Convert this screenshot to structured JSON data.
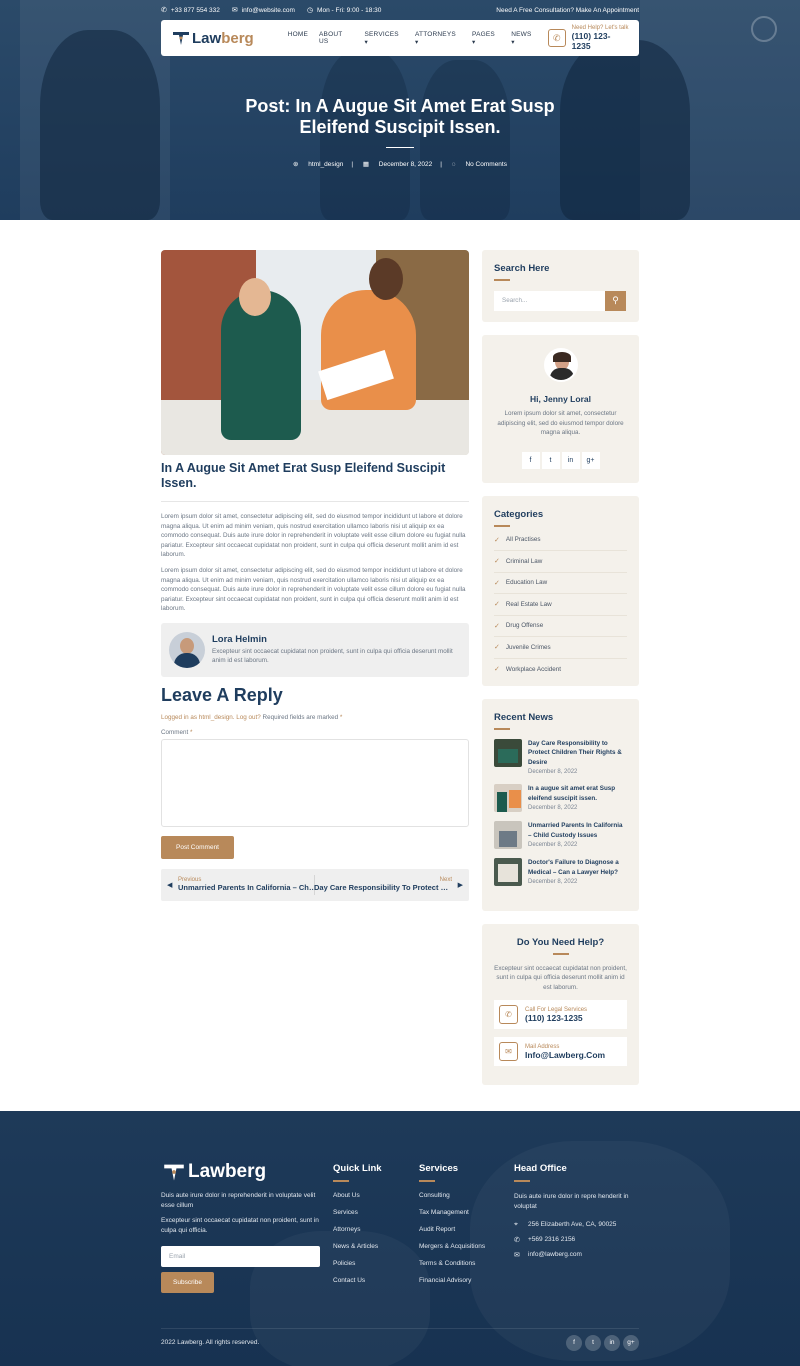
{
  "topbar": {
    "phone": "+33 877 554 332",
    "email": "info@website.com",
    "hours": "Mon - Fri: 9:00 - 18:30",
    "cta": "Need A Free Consultation? Make An Appointment"
  },
  "brand": {
    "name_a": "Law",
    "name_b": "berg"
  },
  "nav": {
    "items": [
      "HOME",
      "ABOUT US",
      "SERVICES ▾",
      "ATTORNEYS ▾",
      "PAGES ▾",
      "NEWS ▾"
    ],
    "help_label": "Need Help? Let's talk",
    "help_phone": "(110) 123-1235"
  },
  "hero": {
    "title_line1": "Post: In A Augue Sit Amet Erat Susp",
    "title_line2": "Eleifend Suscipit Issen.",
    "author": "html_design",
    "date": "December 8, 2022",
    "comments": "No Comments"
  },
  "post": {
    "title": "In A Augue Sit Amet Erat Susp Eleifend Suscipit Issen.",
    "para1": "Lorem ipsum dolor sit amet, consectetur adipiscing elit, sed do eiusmod tempor incididunt ut labore et dolore magna aliqua. Ut enim ad minim veniam, quis nostrud exercitation ullamco laboris nisi ut aliquip ex ea commodo consequat. Duis aute irure dolor in reprehenderit in voluptate velit esse cillum dolore eu fugiat nulla pariatur. Excepteur sint occaecat cupidatat non proident, sunt in culpa qui officia deserunt mollit anim id est laborum.",
    "para2": "Lorem ipsum dolor sit amet, consectetur adipiscing elit, sed do eiusmod tempor incididunt ut labore et dolore magna aliqua. Ut enim ad minim veniam, quis nostrud exercitation ullamco laboris nisi ut aliquip ex ea commodo consequat. Duis aute irure dolor in reprehenderit in voluptate velit esse cillum dolore eu fugiat nulla pariatur. Excepteur sint occaecat cupidatat non proident, sunt in culpa qui officia deserunt mollit anim id est laborum.",
    "author_name": "Lora Helmin",
    "author_bio": "Excepteur sint occaecat cupidatat non proident, sunt in culpa qui officia deserunt mollit anim id est laborum."
  },
  "reply": {
    "heading": "Leave A Reply",
    "logged_link": "Logged in as html_design. Log out?",
    "required": " Required fields are marked ",
    "required_star": "*",
    "comment_label": "Comment ",
    "comment_star": "*",
    "button": "Post Comment"
  },
  "pager": {
    "prev_small": "Previous",
    "prev_title": "Unmarried Parents In California – Child Custody Issues",
    "next_small": "Next",
    "next_title": "Day Care Responsibility To Protect Children Their Rights & Desire"
  },
  "sidebar": {
    "search_title": "Search Here",
    "search_placeholder": "Search...",
    "profile_name": "Hi, Jenny Loral",
    "profile_text": "Lorem ipsum dolor sit amet, consectetur adipiscing elit, sed do eiusmod tempor dolore magna aliqua.",
    "social": [
      "f",
      "t",
      "in",
      "g+"
    ],
    "categories_title": "Categories",
    "categories": [
      "All Practises",
      "Criminal Law",
      "Education Law",
      "Real Estate Law",
      "Drug Offense",
      "Juvenile Crimes",
      "Workplace Accident"
    ],
    "news_title": "Recent News",
    "news": [
      {
        "title": "Day Care Responsibility to Protect Children Their Rights & Desire",
        "date": "December 8, 2022"
      },
      {
        "title": "In a augue sit amet erat Susp eleifend suscipit issen.",
        "date": "December 8, 2022"
      },
      {
        "title": "Unmarried Parents In California – Child Custody Issues",
        "date": "December 8, 2022"
      },
      {
        "title": "Doctor's Failure to Diagnose a Medical – Can a Lawyer Help?",
        "date": "December 8, 2022"
      }
    ],
    "help_title": "Do You Need Help?",
    "help_text": "Excepteur sint occaecat cupidatat non proident, sunt in culpa qui officia deserunt mollit anim id est laborum.",
    "call_label": "Call For Legal Services",
    "call_value": "(110) 123-1235",
    "mail_label": "Mail Address",
    "mail_value": "Info@Lawberg.Com"
  },
  "footer": {
    "about1": "Duis aute irure dolor in reprehenderit in voluptate velit esse cillum",
    "about2": "Excepteur sint occaecat cupidatat non proident, sunt in culpa qui officia.",
    "email_placeholder": "Email",
    "subscribe": "Subscribe",
    "quick_title": "Quick Link",
    "quick": [
      "About Us",
      "Services",
      "Attorneys",
      "News & Articles",
      "Policies",
      "Contact Us"
    ],
    "services_title": "Services",
    "services": [
      "Consulting",
      "Tax Management",
      "Audit Report",
      "Mergers & Acquisitions",
      "Terms & Conditions",
      "Financial Advisory"
    ],
    "office_title": "Head Office",
    "office_text": "Duis aute irure dolor in repre henderit in voluptat",
    "address": "256 Elizaberth Ave, CA, 90025",
    "phone": "+569 2316 2156",
    "email": "info@lawberg.com",
    "copyright": "2022 Lawberg. All rights reserved.",
    "social": [
      "f",
      "t",
      "in",
      "g+"
    ]
  },
  "colors": {
    "primary": "#1f3d5e",
    "accent": "#b8895a",
    "panel": "#f4f1eb"
  }
}
